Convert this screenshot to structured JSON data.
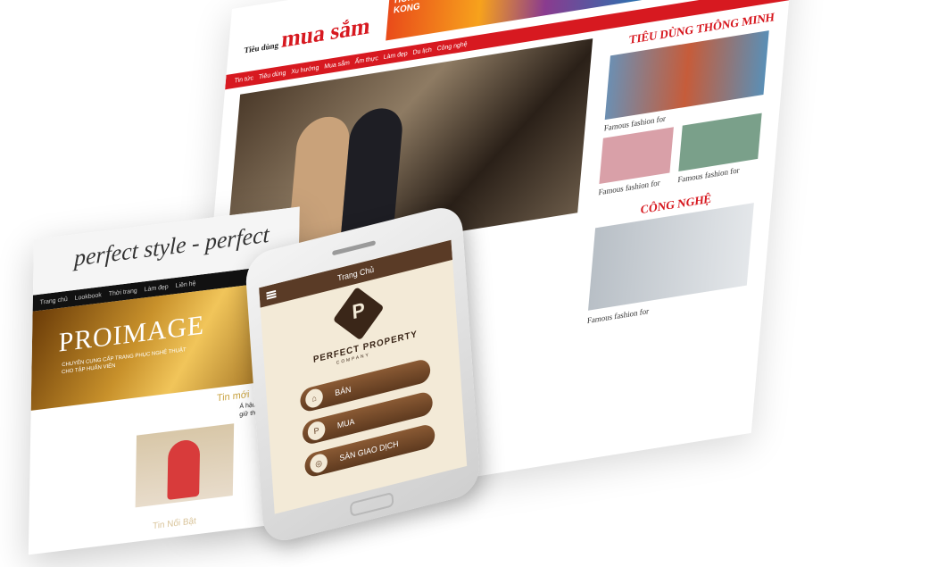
{
  "news": {
    "logo_small": "Tiêu dùng",
    "logo": "mua sắm",
    "banner": "HONG KONG",
    "nav": [
      "Tin tức",
      "Tiêu dùng",
      "Xu hướng",
      "Mua sắm",
      "Ẩm thực",
      "Làm đẹp",
      "Du lịch",
      "Công nghệ"
    ],
    "section_smart": "TIÊU DÙNG THÔNG MINH",
    "section_tech": "CÔNG NGHỆ",
    "caption_1": "Famous fashion for",
    "caption_2": "Famous fashion for",
    "caption_3": "Famous fashion for",
    "caption_4": "Famous fashion for"
  },
  "fashion": {
    "script_title": "perfect style - perfect",
    "nav": [
      "Trang chủ",
      "Lookbook",
      "Thời trang",
      "Làm đẹp",
      "Liên hệ"
    ],
    "banner_title": "PROIMAGE",
    "banner_sub": "CHUYÊN CUNG CẤP TRANG PHỤC NGHỆ THUẬT CHO TẬP HUẤN VIÊN",
    "latest": "Tin mới",
    "headline": "Á hậu Thu Hương giữ thương Top",
    "featured": "Tin Nổi Bật"
  },
  "phone": {
    "title": "Trang Chủ",
    "brand": "PERFECT PROPERTY",
    "brand_sub": "COMPANY",
    "buttons": [
      "BÁN",
      "MUA",
      "SÀN GIAO DỊCH"
    ]
  }
}
